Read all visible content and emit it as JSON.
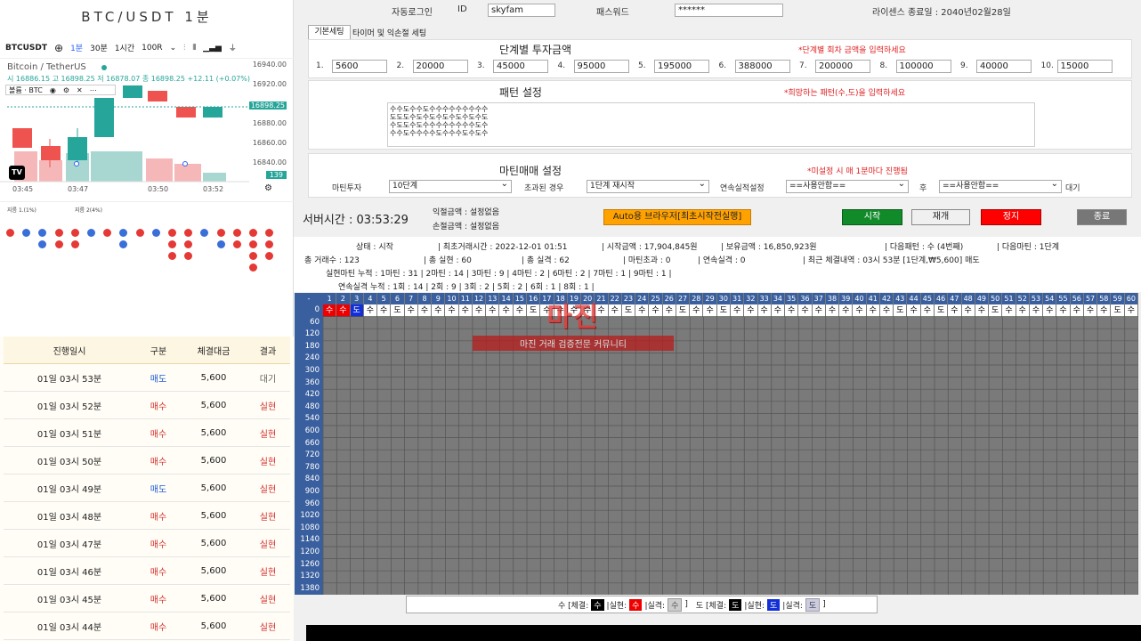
{
  "left": {
    "title": "BTC/USDT 1분",
    "toolbar": {
      "symbol": "BTCUSDT",
      "plus": "⊕",
      "intervals": [
        "1분",
        "30분",
        "1시간",
        "100R"
      ]
    },
    "pair": "Bitcoin / TetherUS",
    "ohlc": "시 16886.15 고 16898.25 저 16878.07 종 16898.25 +12.11 (+0.07%)",
    "indicator": "볼륨 · BTC",
    "axis": [
      "16940.00",
      "16920.00",
      "16898.25",
      "16880.00",
      "16860.00",
      "16840.00",
      "139"
    ],
    "times": [
      "03:45",
      "03:47",
      "03:50",
      "03:52"
    ],
    "legend_a": "지름 1.(1%)",
    "legend_b": "지름 2(4%)",
    "table_headers": [
      "진행일시",
      "구분",
      "체결대금",
      "결과"
    ],
    "rows": [
      {
        "date": "01일 03시 53분",
        "type": "매도",
        "amount": "5,600",
        "result": "대기"
      },
      {
        "date": "01일 03시 52분",
        "type": "매수",
        "amount": "5,600",
        "result": "실현"
      },
      {
        "date": "01일 03시 51분",
        "type": "매수",
        "amount": "5,600",
        "result": "실현"
      },
      {
        "date": "01일 03시 50분",
        "type": "매수",
        "amount": "5,600",
        "result": "실현"
      },
      {
        "date": "01일 03시 49분",
        "type": "매도",
        "amount": "5,600",
        "result": "실현"
      },
      {
        "date": "01일 03시 48분",
        "type": "매수",
        "amount": "5,600",
        "result": "실현"
      },
      {
        "date": "01일 03시 47분",
        "type": "매수",
        "amount": "5,600",
        "result": "실현"
      },
      {
        "date": "01일 03시 46분",
        "type": "매수",
        "amount": "5,600",
        "result": "실현"
      },
      {
        "date": "01일 03시 45분",
        "type": "매수",
        "amount": "5,600",
        "result": "실현"
      },
      {
        "date": "01일 03시 44분",
        "type": "매수",
        "amount": "5,600",
        "result": "실현"
      }
    ]
  },
  "top": {
    "autologin": "자동로그인",
    "id_label": "ID",
    "id_value": "skyfam",
    "pw_label": "패스워드",
    "pw_value": "******",
    "license": "라이센스 종료일 :  2040년02월28일"
  },
  "tabs": [
    "기본세팅",
    "타이머 및 익손절 세팅"
  ],
  "invest": {
    "title": "단계별 투자금액",
    "hint": "*단계별 회차 금액을 입력하세요",
    "steps": [
      "5600",
      "20000",
      "45000",
      "95000",
      "195000",
      "388000",
      "200000",
      "100000",
      "40000",
      "15000"
    ]
  },
  "pattern": {
    "title": "패턴 설정",
    "hint": "*희망하는 패턴(수,도)을 입력하세요",
    "lines": [
      "수수도수수도수수수수수수수수수",
      "도도도수도수도수도수도수도수도",
      "수도도수도수수수수수수수수도수",
      "수수도수수수수도수수수도수도수"
    ]
  },
  "martin": {
    "title": "마틴매매 설정",
    "hint": "*미설정 시 매 1분마다 진행됨",
    "inv_label": "마틴투자",
    "inv_value": "10단계",
    "over_label": "초과된 경우",
    "over_value": "1단계 재시작",
    "cons_label": "연속실적설정",
    "cons_value": "==사용안함==",
    "after": "후",
    "after_value": "==사용안함==",
    "wait": "대기"
  },
  "server": {
    "label": "서버시간 : 03:53:29",
    "profit": "익절금액 :  설정없음",
    "loss": "손절금액 :  설정없음",
    "auto_btn": "Auto용 브라우저[최초시작전실행]",
    "start": "시작",
    "resume": "재개",
    "stop": "정지",
    "end": "종료"
  },
  "status": {
    "line1": [
      "상태 : 시작",
      "| 최초거래시간 : 2022-12-01 01:51",
      "| 시작금액 : 17,904,845원",
      "| 보유금액 : 16,850,923원",
      "| 다음패턴 : 수 (4번째)",
      "| 다음마틴 : 1단계"
    ],
    "line2": [
      "총 거래수 : 123",
      "| 총 실현 : 60",
      "| 총 실격 : 62",
      "| 마틴초과 : 0",
      "| 연속실격 : 0",
      "| 최근 체결내역 : 03시 53분 [1단계,₩5,600] 매도"
    ],
    "line3": "실현마틴 누적 :    1마틴 : 31 | 2마틴 : 14 | 3마틴 : 9 | 4마틴 : 2 | 6마틴 : 2 | 7마틴 : 1 | 9마틴 : 1 |",
    "line4": "연속실격 누적 :    1회 : 14 | 2회 : 9 | 3회 : 2 | 5회 : 2 | 6회 : 1 | 8회 : 1 |"
  },
  "grid": {
    "rows": [
      "0",
      "60",
      "120",
      "180",
      "240",
      "300",
      "360",
      "420",
      "480",
      "540",
      "600",
      "660",
      "720",
      "780",
      "840",
      "900",
      "960",
      "1020",
      "1080",
      "1140",
      "1200",
      "1260",
      "1320",
      "1380"
    ],
    "row0": [
      "수",
      "수",
      "도",
      "수",
      "수",
      "도",
      "수",
      "수",
      "수",
      "수",
      "수",
      "수",
      "수",
      "수",
      "수",
      "도",
      "수",
      "수",
      "수",
      "수",
      "수",
      "수",
      "도",
      "수",
      "수",
      "수",
      "도",
      "수",
      "수",
      "도",
      "수",
      "수",
      "수",
      "수",
      "수",
      "수",
      "수",
      "수",
      "수",
      "수",
      "수",
      "수",
      "도",
      "수",
      "수",
      "도",
      "수",
      "수",
      "수",
      "도",
      "수",
      "수",
      "수",
      "수",
      "수",
      "수",
      "수",
      "수",
      "도",
      "수"
    ],
    "watermark": "마진",
    "watermark_sub": "마진 거래 검증전문 커뮤니티"
  },
  "legend": {
    "su": "수 [체결:",
    "su_mid1": "|실현:",
    "su_mid2": "|실격:",
    "su_end": "]",
    "do": "도 [체결:",
    "do_mid1": "|실현:",
    "do_mid2": "|실격:",
    "do_end": "]",
    "su_g": "수",
    "do_g": "도"
  }
}
